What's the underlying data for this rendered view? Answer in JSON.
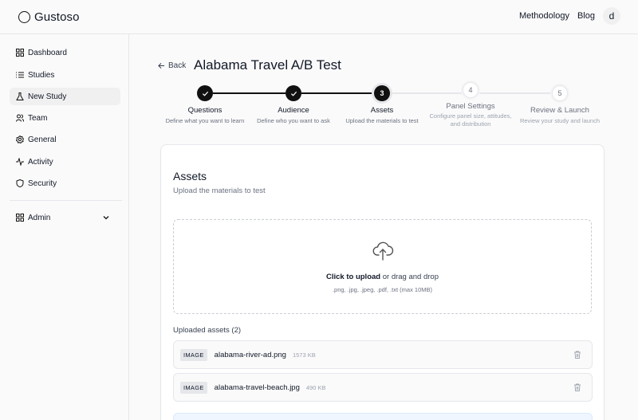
{
  "brand": {
    "name": "Gustoso"
  },
  "topnav": {
    "methodology": "Methodology",
    "blog": "Blog",
    "avatar_initial": "d"
  },
  "sidebar": {
    "items": [
      {
        "label": "Dashboard",
        "icon": "dashboard-icon"
      },
      {
        "label": "Studies",
        "icon": "list-icon"
      },
      {
        "label": "New Study",
        "icon": "flask-icon",
        "active": true
      },
      {
        "label": "Team",
        "icon": "users-icon"
      },
      {
        "label": "General",
        "icon": "gear-icon"
      },
      {
        "label": "Activity",
        "icon": "activity-icon"
      },
      {
        "label": "Security",
        "icon": "shield-icon"
      }
    ],
    "admin": {
      "label": "Admin",
      "icon": "dashboard-icon"
    }
  },
  "page": {
    "back_label": "Back",
    "title": "Alabama Travel A/B Test"
  },
  "stepper": {
    "steps": [
      {
        "number": "1",
        "title": "Questions",
        "desc": "Define what you want to learn",
        "status": "done"
      },
      {
        "number": "2",
        "title": "Audience",
        "desc": "Define who you want to ask",
        "status": "done"
      },
      {
        "number": "3",
        "title": "Assets",
        "desc": "Upload the materials to test",
        "status": "current"
      },
      {
        "number": "4",
        "title": "Panel Settings",
        "desc_line1": "Configure panel size, attitudes,",
        "desc_line2": "and distribution",
        "status": "todo"
      },
      {
        "number": "5",
        "title": "Review & Launch",
        "desc": "Review your study and launch",
        "status": "todo"
      }
    ]
  },
  "assets_card": {
    "title": "Assets",
    "subtitle": "Upload the materials to test",
    "dropzone": {
      "click_label": "Click to upload",
      "or_label": " or drag and drop",
      "hint": ".png, .jpg, .jpeg, .pdf, .txt (max 10MB)"
    },
    "uploaded_label": "Uploaded assets (2)",
    "files": [
      {
        "type": "IMAGE",
        "name": "alabama-river-ad.png",
        "size": "1573 KB"
      },
      {
        "type": "IMAGE",
        "name": "alabama-travel-beach.jpg",
        "size": "490 KB"
      }
    ]
  }
}
